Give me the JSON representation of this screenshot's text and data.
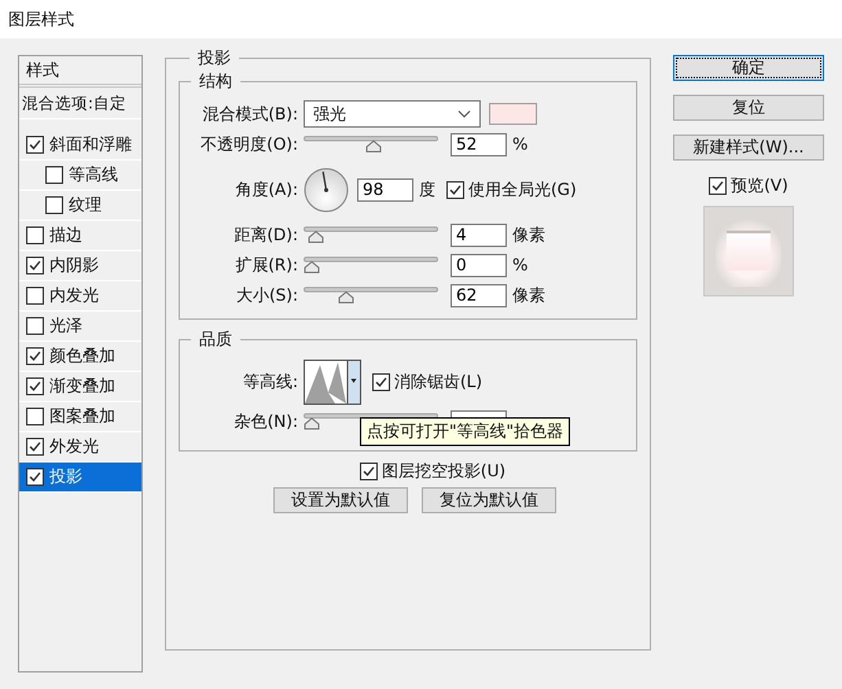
{
  "window": {
    "title": "图层样式"
  },
  "styles_panel": {
    "header": "样式",
    "blend_options": "混合选项:自定",
    "items": [
      {
        "label": "斜面和浮雕",
        "checked": true,
        "selected": false,
        "children": [
          {
            "label": "等高线",
            "checked": false,
            "selected": false
          },
          {
            "label": "纹理",
            "checked": false,
            "selected": false
          }
        ]
      },
      {
        "label": "描边",
        "checked": false,
        "selected": false
      },
      {
        "label": "内阴影",
        "checked": true,
        "selected": false
      },
      {
        "label": "内发光",
        "checked": false,
        "selected": false
      },
      {
        "label": "光泽",
        "checked": false,
        "selected": false
      },
      {
        "label": "颜色叠加",
        "checked": true,
        "selected": false
      },
      {
        "label": "渐变叠加",
        "checked": true,
        "selected": false
      },
      {
        "label": "图案叠加",
        "checked": false,
        "selected": false
      },
      {
        "label": "外发光",
        "checked": true,
        "selected": false
      },
      {
        "label": "投影",
        "checked": true,
        "selected": true
      }
    ]
  },
  "drop_shadow": {
    "title": "投影",
    "structure": {
      "title": "结构",
      "blend_mode": {
        "label": "混合模式(B):",
        "value": "强光",
        "color": "#fde6e6"
      },
      "opacity": {
        "label": "不透明度(O):",
        "level": 0.52,
        "value": "52",
        "unit": "%"
      },
      "angle": {
        "label": "角度(A):",
        "value": "98",
        "unit": "度",
        "global_light": {
          "label": "使用全局光(G)",
          "checked": true
        }
      },
      "distance": {
        "label": "距离(D):",
        "level": 0.03,
        "value": "4",
        "unit": "像素"
      },
      "spread": {
        "label": "扩展(R):",
        "level": 0,
        "value": "0",
        "unit": "%"
      },
      "size": {
        "label": "大小(S):",
        "level": 0.29,
        "value": "62",
        "unit": "像素"
      }
    },
    "quality": {
      "title": "品质",
      "contour": {
        "label": "等高线:"
      },
      "anti_aliased": {
        "label": "消除锯齿(L)",
        "checked": true
      },
      "noise": {
        "label": "杂色(N):",
        "level": 0
      }
    },
    "knockout": {
      "label": "图层挖空投影(U)",
      "checked": true
    },
    "buttons": [
      "设置为默认值",
      "复位为默认值"
    ]
  },
  "tooltip": "点按可打开\"等高线\"拾色器",
  "actions": {
    "buttons": [
      {
        "label": "确定",
        "selected": true
      },
      {
        "label": "复位",
        "selected": false
      },
      {
        "label": "新建样式(W)...",
        "selected": false
      }
    ],
    "preview": {
      "label": "预览(V)",
      "checked": true
    }
  }
}
